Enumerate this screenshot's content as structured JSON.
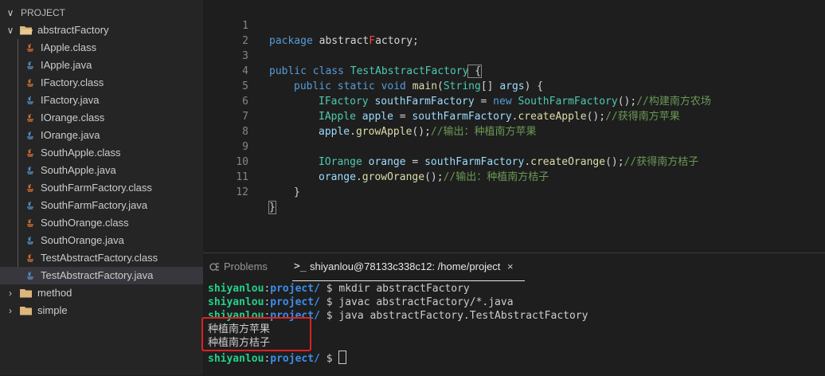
{
  "sidebar": {
    "header": "PROJECT",
    "folder": "abstractFactory",
    "files": [
      {
        "name": "IApple.class",
        "kind": "class"
      },
      {
        "name": "IApple.java",
        "kind": "java"
      },
      {
        "name": "IFactory.class",
        "kind": "class"
      },
      {
        "name": "IFactory.java",
        "kind": "java"
      },
      {
        "name": "IOrange.class",
        "kind": "class"
      },
      {
        "name": "IOrange.java",
        "kind": "java"
      },
      {
        "name": "SouthApple.class",
        "kind": "class"
      },
      {
        "name": "SouthApple.java",
        "kind": "java"
      },
      {
        "name": "SouthFarmFactory.class",
        "kind": "class"
      },
      {
        "name": "SouthFarmFactory.java",
        "kind": "java"
      },
      {
        "name": "SouthOrange.class",
        "kind": "class"
      },
      {
        "name": "SouthOrange.java",
        "kind": "java"
      },
      {
        "name": "TestAbstractFactory.class",
        "kind": "class"
      },
      {
        "name": "TestAbstractFactory.java",
        "kind": "java"
      }
    ],
    "other_folders": [
      "method",
      "simple"
    ]
  },
  "editor": {
    "line_numbers": [
      "1",
      "2",
      "3",
      "4",
      "5",
      "6",
      "7",
      "8",
      "9",
      "10",
      "11",
      "12"
    ],
    "l1": {
      "kw": "package",
      "pkg_a": " abstract",
      "pkg_b": "F",
      "pkg_c": "actory;"
    },
    "l3": {
      "kw": "public class",
      "cls": " TestAbstractFactory",
      "brace": " {"
    },
    "l4": {
      "kw": "public static void",
      "fn": " main",
      "p1": "(",
      "ty": "String",
      "p2": "[] ",
      "vr": "args",
      "p3": ") {"
    },
    "l5": {
      "ty": "IFactory",
      "vr": " southFarmFactory",
      "op": " = ",
      "kw": "new",
      "fn": " SouthFarmFactory",
      "p": "();",
      "cm": "//构建南方农场"
    },
    "l6": {
      "ty": "IApple",
      "vr": " apple",
      "op": " = ",
      "vr2": "southFarmFactory",
      "p1": ".",
      "fn": "createApple",
      "p2": "();",
      "cm": "//获得南方苹果"
    },
    "l7": {
      "vr": "apple",
      "p1": ".",
      "fn": "growApple",
      "p2": "();",
      "cm": "//输出：种植南方苹果"
    },
    "l9": {
      "ty": "IOrange",
      "vr": " orange",
      "op": " = ",
      "vr2": "southFarmFactory",
      "p1": ".",
      "fn": "createOrange",
      "p2": "();",
      "cm": "//获得南方桔子"
    },
    "l10": {
      "vr": "orange",
      "p1": ".",
      "fn": "growOrange",
      "p2": "();",
      "cm": "//输出：种植南方桔子"
    },
    "l11": {
      "brace": "}"
    },
    "l12": {
      "brace": "}"
    }
  },
  "panel": {
    "tabs": {
      "problems": "Problems",
      "terminal": "shiyanlou@78133c338c12: /home/project"
    },
    "prompt_user": "shiyanlou",
    "prompt_sep": ":",
    "prompt_dir": "project/",
    "prompt_sign": " $ ",
    "commands": [
      "mkdir abstractFactory",
      "javac abstractFactory/*.java",
      "java abstractFactory.TestAbstractFactory"
    ],
    "outputs": [
      "种植南方苹果",
      "种植南方桔子"
    ]
  },
  "colors": {
    "highlight_box": "#e02020",
    "prompt_user": "#23d18b",
    "prompt_dir": "#3b8eea"
  }
}
